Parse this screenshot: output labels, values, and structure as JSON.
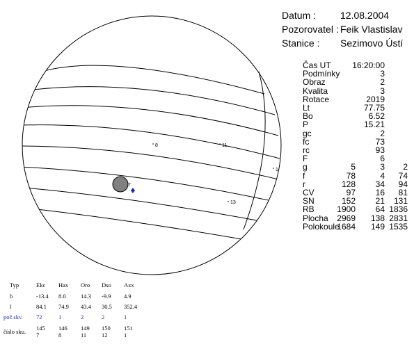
{
  "header": [
    {
      "label": "Datum :",
      "value": "12.08.2004"
    },
    {
      "label": "Pozorovatel :",
      "value": "Feik Vlastislav"
    },
    {
      "label": "Stanice :",
      "value": "Sezimovo Ústí"
    }
  ],
  "stats": [
    {
      "label": "Čas UT",
      "values": [
        "16:20:00"
      ]
    },
    {
      "label": "Podmínky",
      "values": [
        "3"
      ]
    },
    {
      "label": "Obraz",
      "values": [
        "2"
      ]
    },
    {
      "label": "Kvalita",
      "values": [
        "3"
      ]
    },
    {
      "label": "Rotace",
      "values": [
        "2019"
      ]
    },
    {
      "label": "Lt",
      "values": [
        "77.75"
      ]
    },
    {
      "label": "Bo",
      "values": [
        "6.52"
      ]
    },
    {
      "label": "P",
      "values": [
        "15.21"
      ]
    },
    {
      "label": "gc",
      "values": [
        "2"
      ]
    },
    {
      "label": "fc",
      "values": [
        "73"
      ]
    },
    {
      "label": "rc",
      "values": [
        "93"
      ]
    },
    {
      "label": "F",
      "values": [
        "6"
      ]
    },
    {
      "label": "g",
      "values": [
        "5",
        "3",
        "2"
      ]
    },
    {
      "label": "f",
      "values": [
        "78",
        "4",
        "74"
      ]
    },
    {
      "label": "r",
      "values": [
        "128",
        "34",
        "94"
      ]
    },
    {
      "label": "CV",
      "values": [
        "97",
        "16",
        "81"
      ]
    },
    {
      "label": "SN",
      "values": [
        "152",
        "21",
        "131"
      ]
    },
    {
      "label": "RB",
      "values": [
        "1900",
        "64",
        "1836"
      ]
    },
    {
      "label": "Plocha",
      "values": [
        "2969",
        "138",
        "2831"
      ]
    },
    {
      "label": "Polokoule",
      "values": [
        "1684",
        "149",
        "1535"
      ]
    }
  ],
  "disk_groups": [
    "8",
    "11",
    "7",
    "13"
  ],
  "edge_marker": "1",
  "bottom": {
    "headers": [
      "Typ",
      "Ekc",
      "Hax",
      "Oro",
      "Dso",
      "Axx"
    ],
    "rows": [
      {
        "label": "b",
        "values": [
          "-13.4",
          "8.0",
          "14.3",
          "-9.9",
          "4.9"
        ]
      },
      {
        "label": "l",
        "values": [
          "84.1",
          "74.9",
          "43.4",
          "30.5",
          "352.4"
        ]
      },
      {
        "label": "poč.skv.",
        "values": [
          "72",
          "1",
          "2",
          "2",
          "1"
        ]
      }
    ],
    "cislo_label": "číslo sku.",
    "cislo_line1": [
      "145",
      "146",
      "149",
      "150",
      "151"
    ],
    "cislo_line2": [
      "7",
      "8",
      "11",
      "12",
      "1"
    ]
  },
  "colors": {
    "spot_blue": "#1a2fb5",
    "umbra": "#808080"
  }
}
